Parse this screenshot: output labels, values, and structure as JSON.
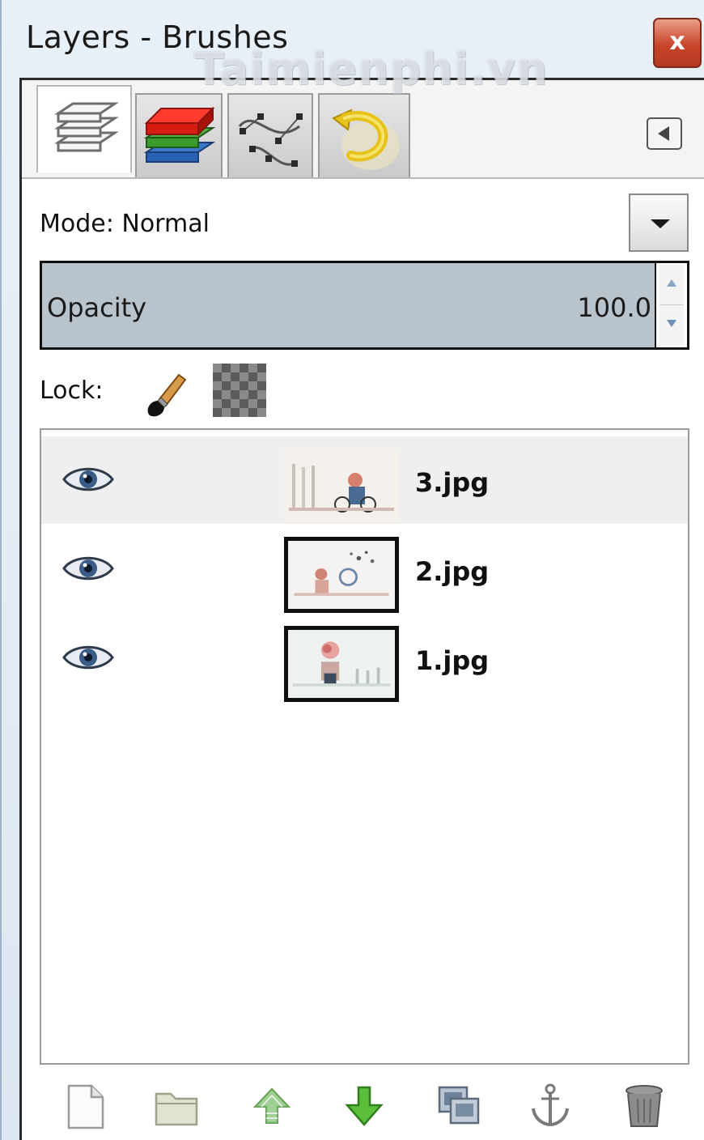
{
  "window": {
    "title": "Layers - Brushes",
    "watermark": "Taimienphi.vn",
    "close_label": "x"
  },
  "tabs": [
    {
      "name": "Layers",
      "icon": "layers-icon",
      "active": true
    },
    {
      "name": "Channels",
      "icon": "channels-icon",
      "active": false
    },
    {
      "name": "Paths",
      "icon": "paths-icon",
      "active": false
    },
    {
      "name": "Undo History",
      "icon": "undo-icon",
      "active": false
    }
  ],
  "mode": {
    "label": "Mode: Normal"
  },
  "opacity": {
    "label": "Opacity",
    "value": "100.0",
    "fraction": 1.0
  },
  "lock": {
    "label": "Lock:"
  },
  "layers": [
    {
      "name": "3.jpg",
      "visible": true,
      "selected": true
    },
    {
      "name": "2.jpg",
      "visible": true,
      "selected": false
    },
    {
      "name": "1.jpg",
      "visible": true,
      "selected": false
    }
  ],
  "toolbar": [
    {
      "name": "new-layer-button",
      "icon": "new-page-icon"
    },
    {
      "name": "new-layer-group-button",
      "icon": "folder-icon"
    },
    {
      "name": "raise-layer-button",
      "icon": "raise-icon"
    },
    {
      "name": "lower-layer-button",
      "icon": "lower-arrow-icon"
    },
    {
      "name": "duplicate-layer-button",
      "icon": "duplicate-icon"
    },
    {
      "name": "anchor-layer-button",
      "icon": "anchor-icon"
    },
    {
      "name": "delete-layer-button",
      "icon": "trash-icon"
    }
  ],
  "colors": {
    "opacity_fill": "#b9c3cc",
    "selected_row": "#efefef",
    "close_button": "#c8442a"
  }
}
